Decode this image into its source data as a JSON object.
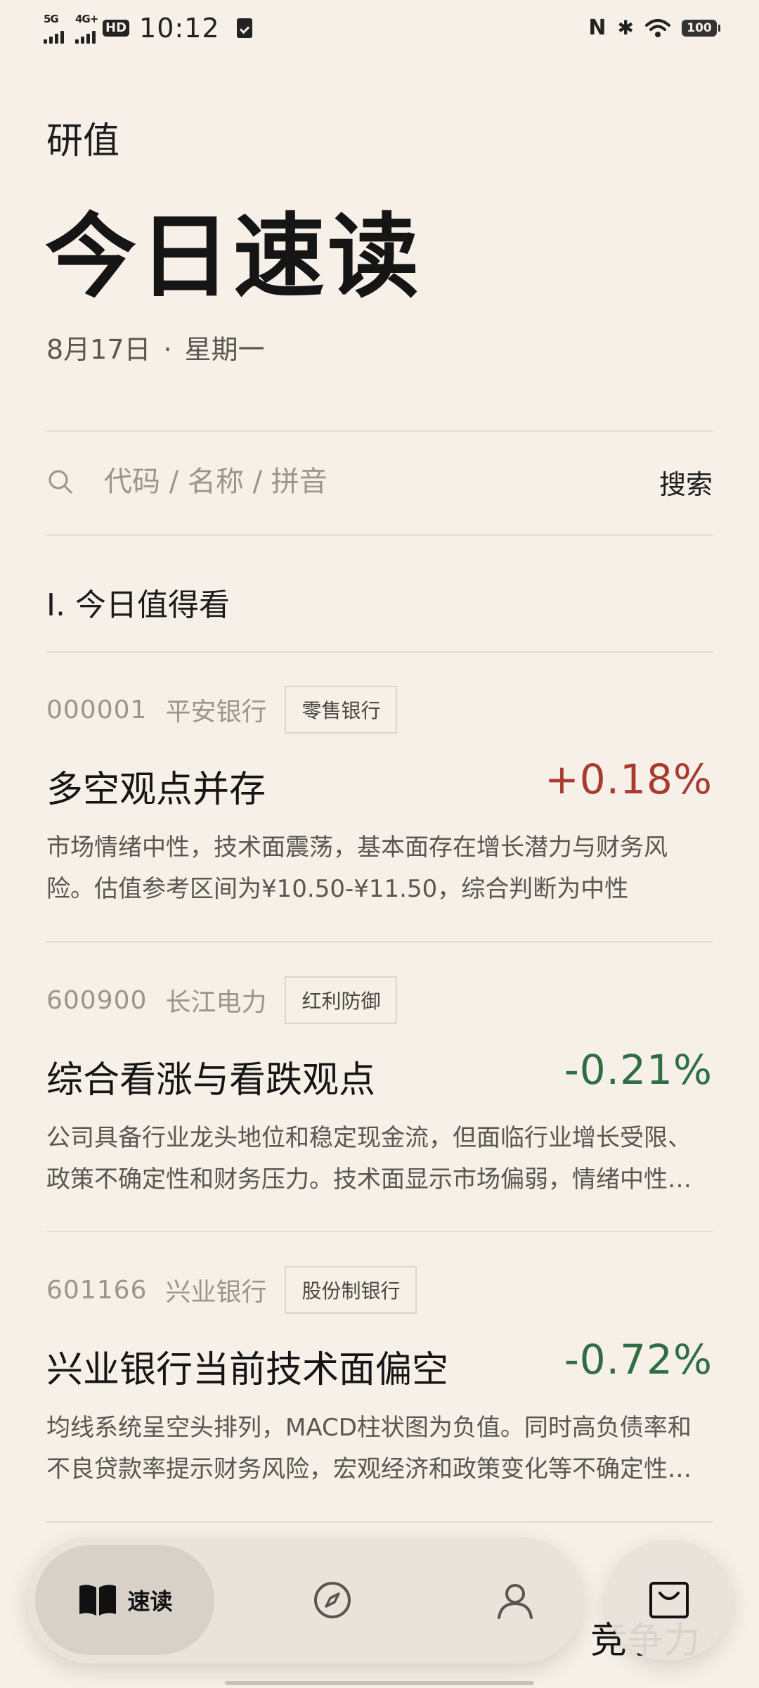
{
  "status_bar": {
    "sig1": "5G",
    "sig2": "4G+",
    "hd": "HD",
    "time": "10:12",
    "nfc": "N",
    "bluetooth": "✱",
    "battery": "100"
  },
  "header": {
    "app_name": "研值",
    "title": "今日速读",
    "date": "8月17日",
    "dot": "·",
    "weekday": "星期一"
  },
  "search": {
    "placeholder": "代码 / 名称 / 拼音",
    "button": "搜索"
  },
  "section": {
    "title": "I. 今日值得看"
  },
  "cards": [
    {
      "code": "000001",
      "name": "平安银行",
      "tag": "零售银行",
      "headline": "多空观点并存",
      "change": "+0.18%",
      "change_color": "#a83a30",
      "summary": "市场情绪中性，技术面震荡，基本面存在增长潜力与财务风险。估值参考区间为¥10.50-¥11.50，综合判断为中性"
    },
    {
      "code": "600900",
      "name": "长江电力",
      "tag": "红利防御",
      "headline": "综合看涨与看跌观点",
      "change": "-0.21%",
      "change_color": "#2f6e45",
      "summary": "公司具备行业龙头地位和稳定现金流，但面临行业增长受限、政策不确定性和财务压力。技术面显示市场偏弱，情绪中性，估值参考区间"
    },
    {
      "code": "601166",
      "name": "兴业银行",
      "tag": "股份制银行",
      "headline": "兴业银行当前技术面偏空",
      "change": "-0.72%",
      "change_color": "#2f6e45",
      "summary": "均线系统呈空头排列，MACD柱状图为负值。同时高负债率和不良贷款率提示财务风险，宏观经济和政策变化等不确定性因素较多"
    }
  ],
  "peek": {
    "headline_right": "竞争力"
  },
  "nav": {
    "read_label": "速读",
    "read_icon": "book-icon",
    "discover_icon": "compass-icon",
    "profile_icon": "user-icon",
    "cart_icon": "shopping-bag-icon"
  }
}
